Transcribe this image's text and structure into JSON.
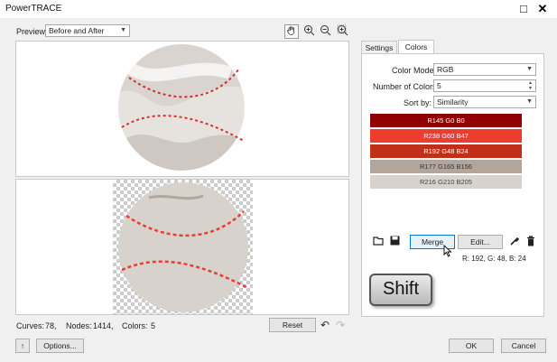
{
  "window": {
    "title": "PowerTRACE",
    "maximize_glyph": "□",
    "close_glyph": "✕"
  },
  "toolbar": {
    "preview_label": "Preview:",
    "preview_value": "Before and After",
    "icons": [
      "pan-icon",
      "zoom-in-icon",
      "zoom-out-icon",
      "zoom-fit-icon"
    ]
  },
  "tabs": [
    {
      "label": "Settings",
      "active": false
    },
    {
      "label": "Colors",
      "active": true
    }
  ],
  "colors_panel": {
    "color_mode_label": "Color Mode:",
    "color_mode_value": "RGB",
    "num_colors_label": "Number of Colors:",
    "num_colors_value": "5",
    "sort_by_label": "Sort by:",
    "sort_by_value": "Similarity",
    "swatches": [
      {
        "label": "R145 G0 B0",
        "hex": "#910000"
      },
      {
        "label": "R238 G60 B47",
        "hex": "#ee3c2f"
      },
      {
        "label": "R192 G48 B24",
        "hex": "#c03018"
      },
      {
        "label": "R177 G165 B156",
        "hex": "#b1a59c"
      },
      {
        "label": "R216 G210 B205",
        "hex": "#d8d2cd"
      }
    ],
    "merge_label": "Merge",
    "edit_label": "Edit...",
    "selected_rgb": "R: 192, G: 48, B: 24"
  },
  "overlay": {
    "key_label": "Shift"
  },
  "stats": {
    "curves_label": "Curves:",
    "curves_value": "78,",
    "nodes_label": "Nodes:",
    "nodes_value": "1414,",
    "colors_label": "Colors:",
    "colors_value": "5"
  },
  "buttons": {
    "reset": "Reset",
    "help": "↑",
    "options": "Options...",
    "ok": "OK",
    "cancel": "Cancel"
  }
}
